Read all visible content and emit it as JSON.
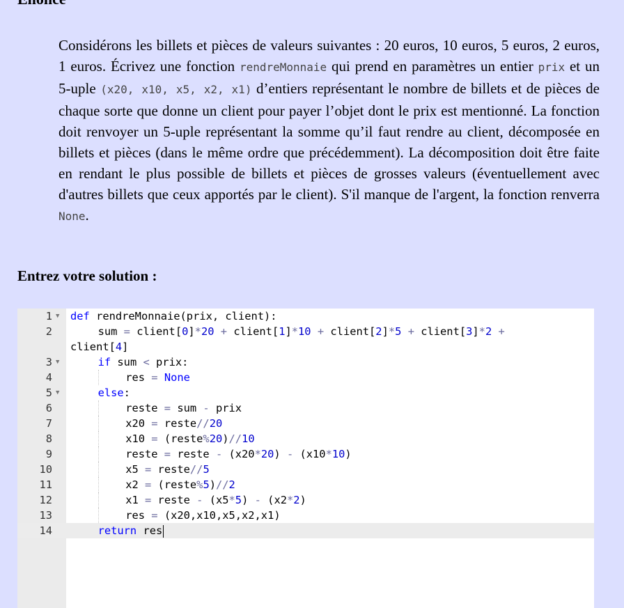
{
  "page": {
    "top_heading": "Enoncé",
    "solution_heading": "Entrez votre solution :"
  },
  "statement": {
    "p1": "Considérons les billets et pièces de valeurs suivantes : 20 euros, 10 euros, 5 euros, 2 euros, 1 euros. Écrivez une fonction ",
    "code_fn": "rendreMonnaie",
    "p2": " qui prend en paramètres un entier ",
    "code_prix": "prix",
    "p3": " et un 5-uple ",
    "code_tuple": "(x20, x10, x5, x2, x1)",
    "p4": " d’entiers représentant le nombre de billets et de pièces de chaque sorte que donne un client pour payer l’objet dont le prix est mentionné. La fonction doit renvoyer un 5-uple représentant la somme qu’il faut rendre au client, décomposée en billets et pièces (dans le même ordre que précédemment). La décomposition doit être faite en rendant le plus possible de billets et pièces de grosses valeurs (éventuellement avec d'autres billets que ceux apportés par le client). S'il manque de l'argent, la fonction renverra ",
    "code_none": "None",
    "p5": "."
  },
  "editor": {
    "active_line": 14,
    "lines": [
      {
        "n": "1",
        "fold": true,
        "indent": 0,
        "tokens": [
          [
            "kw",
            "def"
          ],
          [
            "t",
            " rendreMonnaie(prix, client):"
          ]
        ]
      },
      {
        "n": "2",
        "fold": false,
        "indent": 1,
        "wrap": true,
        "tokens": [
          [
            "t",
            "sum "
          ],
          [
            "op",
            "="
          ],
          [
            "t",
            " client["
          ],
          [
            "num",
            "0"
          ],
          [
            "t",
            "]"
          ],
          [
            "op",
            "*"
          ],
          [
            "num",
            "20"
          ],
          [
            "t",
            " "
          ],
          [
            "op",
            "+"
          ],
          [
            "t",
            " client["
          ],
          [
            "num",
            "1"
          ],
          [
            "t",
            "]"
          ],
          [
            "op",
            "*"
          ],
          [
            "num",
            "10"
          ],
          [
            "t",
            " "
          ],
          [
            "op",
            "+"
          ],
          [
            "t",
            " client["
          ],
          [
            "num",
            "2"
          ],
          [
            "t",
            "]"
          ],
          [
            "op",
            "*"
          ],
          [
            "num",
            "5"
          ],
          [
            "t",
            " "
          ],
          [
            "op",
            "+"
          ],
          [
            "t",
            " client["
          ],
          [
            "num",
            "3"
          ],
          [
            "t",
            "]"
          ],
          [
            "op",
            "*"
          ],
          [
            "num",
            "2"
          ],
          [
            "t",
            " "
          ],
          [
            "op",
            "+"
          ],
          [
            "t",
            "\nclient["
          ],
          [
            "num",
            "4"
          ],
          [
            "t",
            "]"
          ]
        ]
      },
      {
        "n": "3",
        "fold": true,
        "indent": 1,
        "tokens": [
          [
            "kw",
            "if"
          ],
          [
            "t",
            " sum "
          ],
          [
            "op",
            "<"
          ],
          [
            "t",
            " prix:"
          ]
        ]
      },
      {
        "n": "4",
        "fold": false,
        "indent": 2,
        "tokens": [
          [
            "t",
            "res "
          ],
          [
            "op",
            "="
          ],
          [
            "t",
            " "
          ],
          [
            "kw",
            "None"
          ]
        ]
      },
      {
        "n": "5",
        "fold": true,
        "indent": 1,
        "tokens": [
          [
            "kw",
            "else"
          ],
          [
            "t",
            ":"
          ]
        ]
      },
      {
        "n": "6",
        "fold": false,
        "indent": 2,
        "tokens": [
          [
            "t",
            "reste "
          ],
          [
            "op",
            "="
          ],
          [
            "t",
            " sum "
          ],
          [
            "op",
            "-"
          ],
          [
            "t",
            " prix"
          ]
        ]
      },
      {
        "n": "7",
        "fold": false,
        "indent": 2,
        "tokens": [
          [
            "t",
            "x20 "
          ],
          [
            "op",
            "="
          ],
          [
            "t",
            " reste"
          ],
          [
            "op",
            "//"
          ],
          [
            "num",
            "20"
          ]
        ]
      },
      {
        "n": "8",
        "fold": false,
        "indent": 2,
        "tokens": [
          [
            "t",
            "x10 "
          ],
          [
            "op",
            "="
          ],
          [
            "t",
            " (reste"
          ],
          [
            "op",
            "%"
          ],
          [
            "num",
            "20"
          ],
          [
            "t",
            ")"
          ],
          [
            "op",
            "//"
          ],
          [
            "num",
            "10"
          ]
        ]
      },
      {
        "n": "9",
        "fold": false,
        "indent": 2,
        "tokens": [
          [
            "t",
            "reste "
          ],
          [
            "op",
            "="
          ],
          [
            "t",
            " reste "
          ],
          [
            "op",
            "-"
          ],
          [
            "t",
            " (x20"
          ],
          [
            "op",
            "*"
          ],
          [
            "num",
            "20"
          ],
          [
            "t",
            ") "
          ],
          [
            "op",
            "-"
          ],
          [
            "t",
            " (x10"
          ],
          [
            "op",
            "*"
          ],
          [
            "num",
            "10"
          ],
          [
            "t",
            ")"
          ]
        ]
      },
      {
        "n": "10",
        "fold": false,
        "indent": 2,
        "tokens": [
          [
            "t",
            "x5 "
          ],
          [
            "op",
            "="
          ],
          [
            "t",
            " reste"
          ],
          [
            "op",
            "//"
          ],
          [
            "num",
            "5"
          ]
        ]
      },
      {
        "n": "11",
        "fold": false,
        "indent": 2,
        "tokens": [
          [
            "t",
            "x2 "
          ],
          [
            "op",
            "="
          ],
          [
            "t",
            " (reste"
          ],
          [
            "op",
            "%"
          ],
          [
            "num",
            "5"
          ],
          [
            "t",
            ")"
          ],
          [
            "op",
            "//"
          ],
          [
            "num",
            "2"
          ]
        ]
      },
      {
        "n": "12",
        "fold": false,
        "indent": 2,
        "tokens": [
          [
            "t",
            "x1 "
          ],
          [
            "op",
            "="
          ],
          [
            "t",
            " reste "
          ],
          [
            "op",
            "-"
          ],
          [
            "t",
            " (x5"
          ],
          [
            "op",
            "*"
          ],
          [
            "num",
            "5"
          ],
          [
            "t",
            ") "
          ],
          [
            "op",
            "-"
          ],
          [
            "t",
            " (x2"
          ],
          [
            "op",
            "*"
          ],
          [
            "num",
            "2"
          ],
          [
            "t",
            ")"
          ]
        ]
      },
      {
        "n": "13",
        "fold": false,
        "indent": 2,
        "tokens": [
          [
            "t",
            "res "
          ],
          [
            "op",
            "="
          ],
          [
            "t",
            " (x20,x10,x5,x2,x1)"
          ]
        ]
      },
      {
        "n": "14",
        "fold": false,
        "indent": 1,
        "tokens": [
          [
            "kw",
            "return"
          ],
          [
            "t",
            " res"
          ]
        ]
      }
    ]
  }
}
